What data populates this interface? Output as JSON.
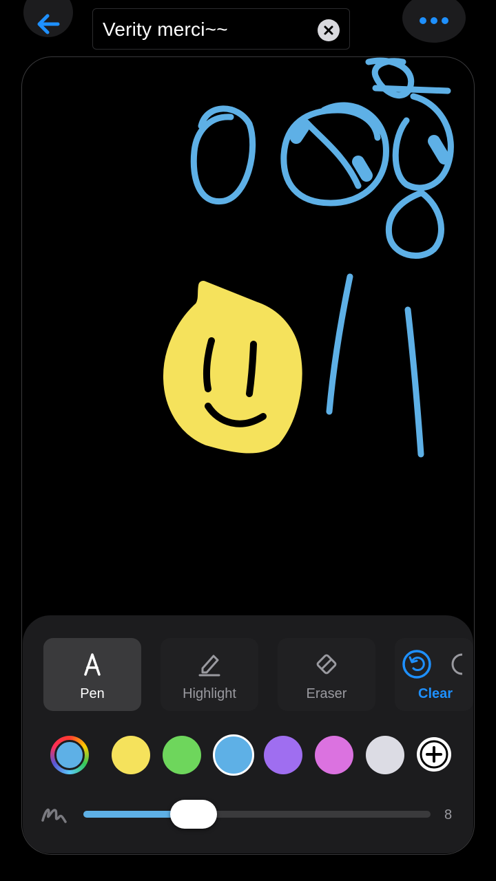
{
  "header": {
    "title": "Verity merci~~",
    "back_icon": "arrow-left-icon",
    "more_icon": "ellipsis-icon",
    "clear_icon": "x-circle-icon"
  },
  "tools": [
    {
      "id": "pen",
      "label": "Pen",
      "icon": "pen-icon",
      "selected": true
    },
    {
      "id": "highlight",
      "label": "Highlight",
      "icon": "highlighter-icon",
      "selected": false
    },
    {
      "id": "eraser",
      "label": "Eraser",
      "icon": "eraser-icon",
      "selected": false
    },
    {
      "id": "clear",
      "label": "Clear",
      "icon": "undo-circle-icon",
      "selected": false
    }
  ],
  "colors": {
    "accent": "#1e90ff",
    "swatches": [
      "#f5e25c",
      "#6ed65c",
      "#5eb0e6",
      "#9f6ef0",
      "#db72e0",
      "#dcdce4"
    ],
    "selected": "#5eb0e6",
    "current": "#5eb0e6"
  },
  "stroke": {
    "width_label": "8",
    "level": 0.19
  }
}
